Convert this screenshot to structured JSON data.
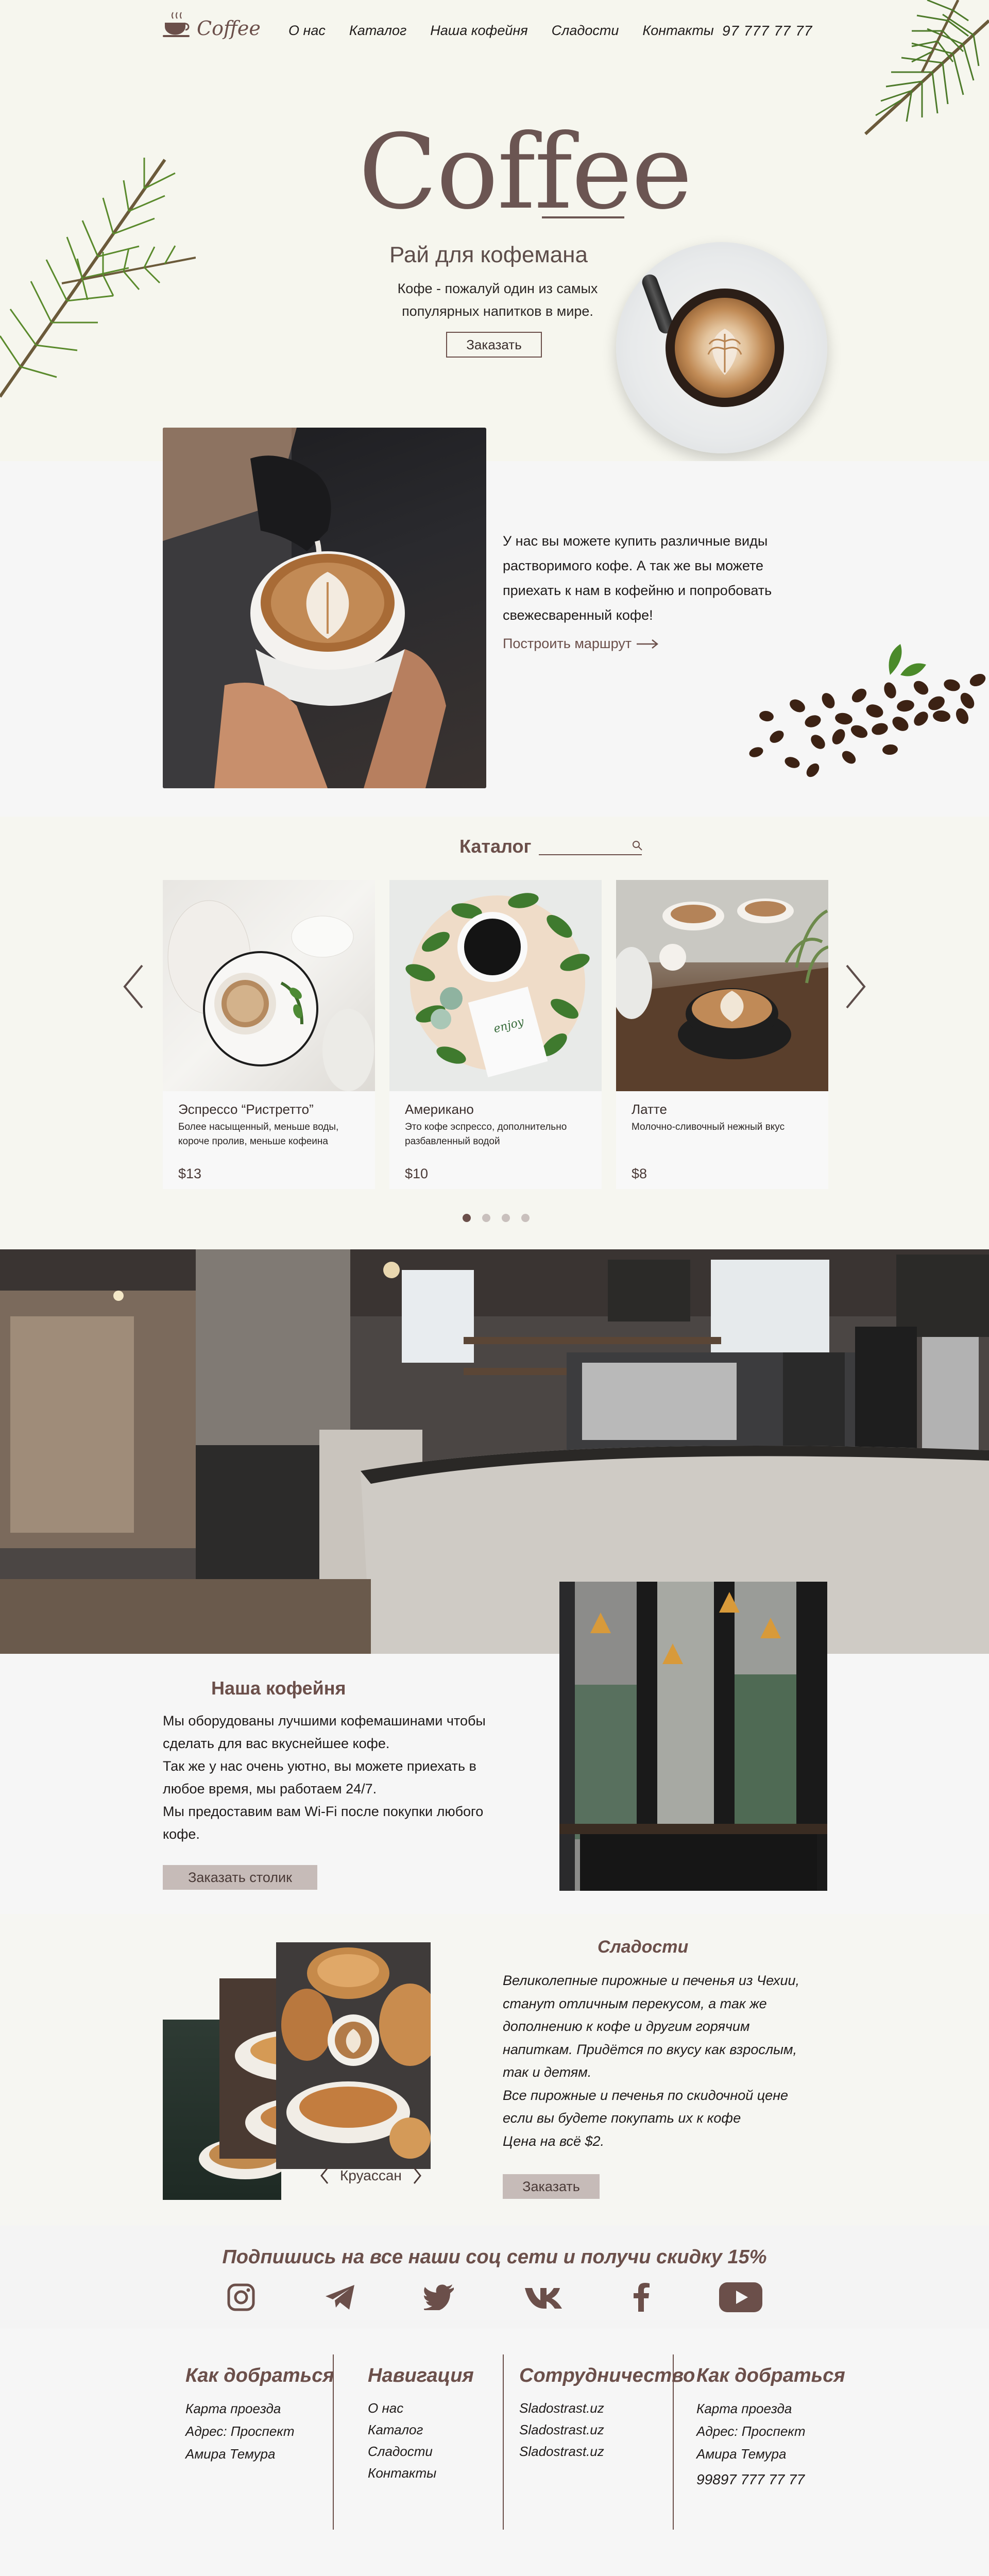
{
  "header": {
    "logo_text": "Coffee",
    "nav": [
      "О нас",
      "Каталог",
      "Наша кофейня",
      "Сладости",
      "Контакты"
    ],
    "phone": "97 777 77 77"
  },
  "hero": {
    "title": "Coffee",
    "subtitle": "Рай для кофемана",
    "description": "Кофе - пожалуй один из самых популярных напитков в мире.",
    "order_button": "Заказать"
  },
  "about": {
    "text": "У нас вы можете купить различные виды растворимого кофе. А так же вы можете приехать к нам в кофейню и попробовать свежесваренный кофе!",
    "route_link": "Построить маршрут"
  },
  "catalog": {
    "title": "Каталог",
    "search_placeholder": "",
    "cards": [
      {
        "name": "Эспрессо “Ристретто”",
        "desc": "Более насыщенный, меньше воды, короче пролив, меньше кофеина",
        "price": "$13"
      },
      {
        "name": "Американо",
        "desc": "Это кофе эспрессо, дополнительно разбавленный водой",
        "price": "$10"
      },
      {
        "name": "Латте",
        "desc": "Молочно-сливочный нежный вкус",
        "price": "$8"
      }
    ],
    "active_page": 1,
    "page_count": 4
  },
  "cafe": {
    "title": "Наша кофейня",
    "paragraphs": [
      "Мы оборудованы лучшими кофемашинами чтобы сделать для вас вкуснейшее кофе.",
      "Так же у нас очень уютно, вы можете приехать в любое время, мы работаем 24/7.",
      "Мы предоставим вам Wi-Fi после покупки любого кофе."
    ],
    "book_button": "Заказать столик"
  },
  "sweets": {
    "title": "Сладости",
    "paragraphs": [
      "Великолепные пирожные и печенья из Чехии, станут отличным перекусом, а так же дополнению к кофе и другим горячим напиткам. Придётся по вкусу как взрослым, так и детям.",
      "Все пирожные и печенья по скидочной цене если вы будете покупать их к кофе",
      "Цена на всё $2."
    ],
    "current_item": "Круассан",
    "order_button": "Заказать"
  },
  "social": {
    "title": "Подпишись на все наши соц сети и получи скидку 15%",
    "icons": [
      "instagram-icon",
      "telegram-icon",
      "twitter-icon",
      "vk-icon",
      "facebook-icon",
      "youtube-icon"
    ]
  },
  "footer": {
    "col1": {
      "title": "Как добраться",
      "lines": [
        "Карта проезда",
        "Адрес: Проспект",
        "Амира Темура"
      ]
    },
    "col2": {
      "title": "Навигация",
      "links": [
        "О нас",
        "Каталог",
        "Сладости",
        "Контакты"
      ]
    },
    "col3": {
      "title": "Сотрудничество",
      "links": [
        "Sladostrast.uz",
        "Sladostrast.uz",
        "Sladostrast.uz"
      ]
    },
    "col4": {
      "title": "Как добраться",
      "lines": [
        "Карта проезда",
        "Адрес: Проспект",
        "Амира Темура",
        "99897 777 77 77"
      ]
    }
  },
  "colors": {
    "brand": "#6b4f4a",
    "button_fill": "#c6bbb8",
    "hero_bg": "#f6f6ee"
  }
}
